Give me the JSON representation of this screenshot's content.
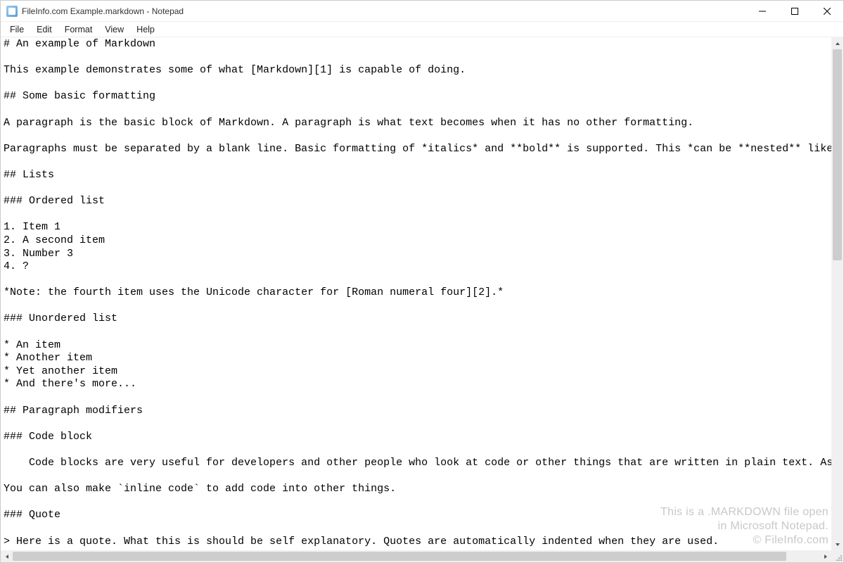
{
  "window": {
    "title": "FileInfo.com Example.markdown - Notepad"
  },
  "menus": {
    "file": "File",
    "edit": "Edit",
    "format": "Format",
    "view": "View",
    "help": "Help"
  },
  "content": "# An example of Markdown\n\nThis example demonstrates some of what [Markdown][1] is capable of doing.\n\n## Some basic formatting\n\nA paragraph is the basic block of Markdown. A paragraph is what text becomes when it has no other formatting.\n\nParagraphs must be separated by a blank line. Basic formatting of *italics* and **bold** is supported. This *can be **nested** like* so.\n\n## Lists\n\n### Ordered list\n\n1. Item 1\n2. A second item\n3. Number 3\n4. ?\n\n*Note: the fourth item uses the Unicode character for [Roman numeral four][2].*\n\n### Unordered list\n\n* An item\n* Another item\n* Yet another item\n* And there's more...\n\n## Paragraph modifiers\n\n### Code block\n\n    Code blocks are very useful for developers and other people who look at code or other things that are written in plain text. As you can see,\n\nYou can also make `inline code` to add code into other things.\n\n### Quote\n\n> Here is a quote. What this is should be self explanatory. Quotes are automatically indented when they are used.",
  "watermark": {
    "line1": "This is a .MARKDOWN file open",
    "line2": "in Microsoft Notepad.",
    "line3": "© FileInfo.com"
  }
}
